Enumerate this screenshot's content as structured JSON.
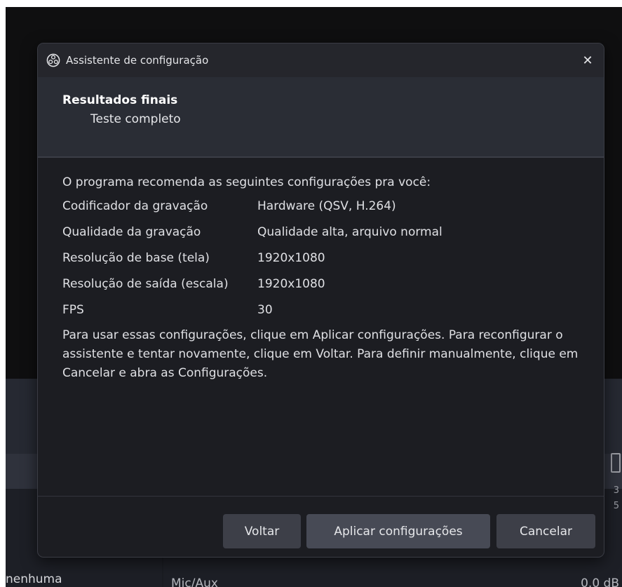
{
  "background": {
    "left_text": "nenhuma",
    "mid_text": "Mic/Aux",
    "right_text": "0.0 dB",
    "widget_digit": "3",
    "widget_digit2": "5"
  },
  "dialog": {
    "title": "Assistente de configuração",
    "close_glyph": "✕",
    "header": {
      "title": "Resultados finais",
      "subtitle": "Teste completo"
    },
    "intro": "O programa recomenda as seguintes configurações pra você:",
    "settings": [
      {
        "label": "Codificador da gravação",
        "value": "Hardware (QSV, H.264)"
      },
      {
        "label": "Qualidade da gravação",
        "value": "Qualidade alta, arquivo normal"
      },
      {
        "label": "Resolução de base (tela)",
        "value": "1920x1080"
      },
      {
        "label": "Resolução de saída (escala)",
        "value": "1920x1080"
      },
      {
        "label": "FPS",
        "value": "30"
      }
    ],
    "info": "Para usar essas configurações, clique em Aplicar configurações. Para reconfigurar o assistente e tentar novamente, clique em Voltar. Para definir manualmente, clique em Cancelar e abra as Configurações.",
    "buttons": {
      "back": "Voltar",
      "apply": "Aplicar configurações",
      "cancel": "Cancelar"
    }
  },
  "icons": {
    "app": "obs-logo-icon",
    "close": "close-icon"
  },
  "colors": {
    "dialog_bg": "#1c1d22",
    "header_bg": "#2a2d35",
    "button_bg": "#3d3f48"
  }
}
